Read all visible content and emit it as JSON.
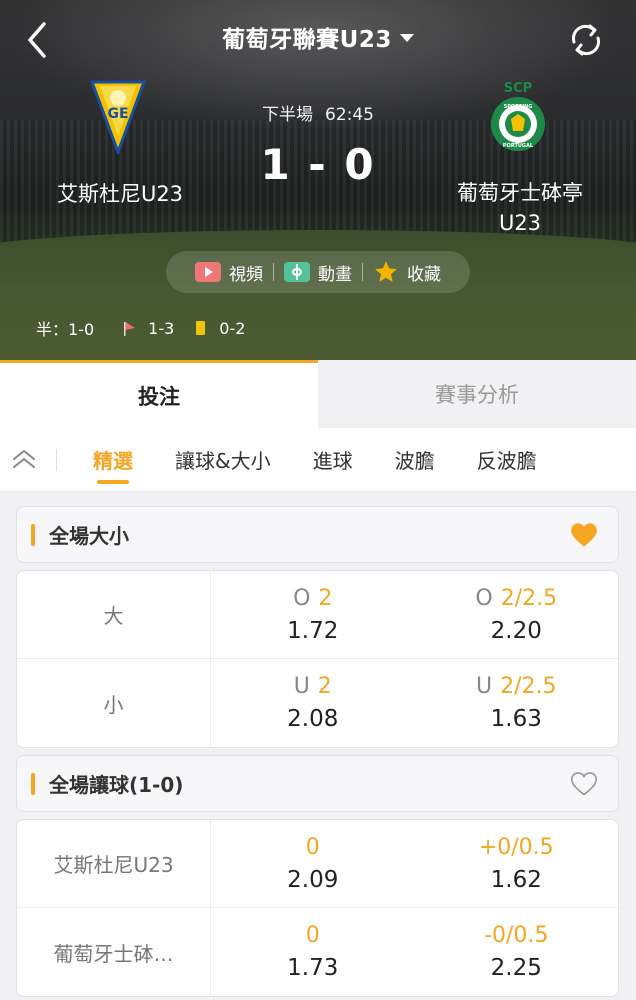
{
  "header": {
    "league_title": "葡萄牙聯賽U23",
    "icons": {
      "back": "chevron-left-icon",
      "refresh": "refresh-icon",
      "dropdown": "caret-down-icon"
    }
  },
  "match": {
    "period": "下半場",
    "clock": "62:45",
    "score": "1 - 0",
    "home_team": "艾斯杜尼U23",
    "away_team_line1": "葡萄牙士砵亭",
    "away_team_line2": "U23",
    "away_logo_text": "SCP",
    "away_logo_ring_top": "SPORTING",
    "away_logo_ring_bottom": "PORTUGAL",
    "home_logo_text": "GE"
  },
  "media": {
    "video_label": "視頻",
    "animation_label": "動畫",
    "favorite_label": "收藏"
  },
  "stats": {
    "half_label": "半：1-0",
    "corners": "1-3",
    "yellow_cards": "0-2"
  },
  "tabs": {
    "main": [
      "投注",
      "賽事分析"
    ],
    "sub": [
      "精選",
      "讓球&大小",
      "進球",
      "波膽",
      "反波膽"
    ]
  },
  "colors": {
    "accent": "#f5a623",
    "text": "#333333",
    "muted": "#888888"
  },
  "markets": [
    {
      "title": "全場大小",
      "favorited": true,
      "rows": [
        {
          "label": "大",
          "cells": [
            {
              "prefix": "O",
              "line": "2",
              "price": "1.72"
            },
            {
              "prefix": "O",
              "line": "2/2.5",
              "price": "2.20"
            }
          ]
        },
        {
          "label": "小",
          "cells": [
            {
              "prefix": "U",
              "line": "2",
              "price": "2.08"
            },
            {
              "prefix": "U",
              "line": "2/2.5",
              "price": "1.63"
            }
          ]
        }
      ]
    },
    {
      "title": "全場讓球(1-0)",
      "favorited": false,
      "rows": [
        {
          "label": "艾斯杜尼U23",
          "cells": [
            {
              "prefix": "",
              "line": "0",
              "price": "2.09"
            },
            {
              "prefix": "",
              "line": "+0/0.5",
              "price": "1.62"
            }
          ]
        },
        {
          "label": "葡萄牙士砵…",
          "cells": [
            {
              "prefix": "",
              "line": "0",
              "price": "1.73"
            },
            {
              "prefix": "",
              "line": "-0/0.5",
              "price": "2.25"
            }
          ]
        }
      ]
    }
  ]
}
